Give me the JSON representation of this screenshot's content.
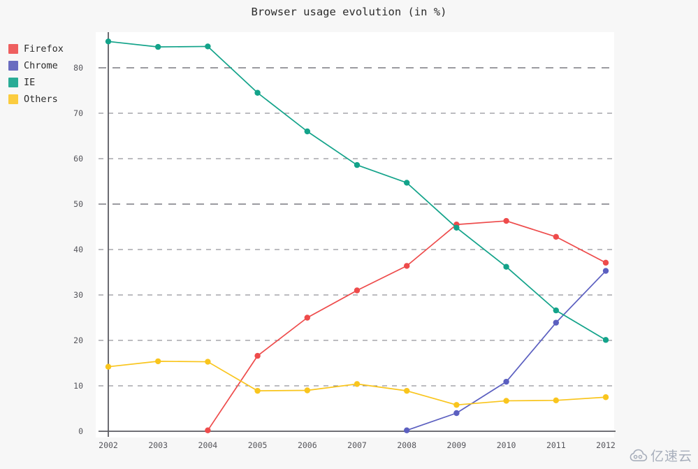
{
  "chart_data": {
    "type": "line",
    "title": "Browser usage evolution (in %)",
    "xlabel": "",
    "ylabel": "",
    "grid": true,
    "legend_position": "top-left-outside",
    "x": [
      2002,
      2003,
      2004,
      2005,
      2006,
      2007,
      2008,
      2009,
      2010,
      2011,
      2012
    ],
    "categories": [
      "2002",
      "2003",
      "2004",
      "2005",
      "2006",
      "2007",
      "2008",
      "2009",
      "2010",
      "2011",
      "2012"
    ],
    "xlim": [
      2002,
      2012
    ],
    "ylim": [
      0,
      86
    ],
    "yticks": [
      0,
      10,
      20,
      30,
      40,
      50,
      60,
      70,
      80
    ],
    "ytick_labels": [
      "0",
      "10",
      "20",
      "30",
      "40",
      "50",
      "60",
      "70",
      "80"
    ],
    "series": [
      {
        "name": "Firefox",
        "color": "#ee4b4b",
        "values": [
          null,
          null,
          0.2,
          16.6,
          25.0,
          31.0,
          36.4,
          45.5,
          46.3,
          42.8,
          37.1
        ]
      },
      {
        "name": "Chrome",
        "color": "#5b5fc0",
        "values": [
          null,
          null,
          null,
          null,
          null,
          null,
          0.2,
          4.0,
          10.9,
          23.9,
          35.3
        ]
      },
      {
        "name": "IE",
        "color": "#13a38a",
        "values": [
          85.8,
          84.6,
          84.7,
          74.5,
          66.0,
          58.6,
          54.7,
          44.8,
          36.2,
          26.6,
          20.1
        ]
      },
      {
        "name": "Others",
        "color": "#f9c51d",
        "values": [
          14.2,
          15.4,
          15.3,
          8.9,
          9.0,
          10.4,
          8.9,
          5.8,
          6.7,
          6.8,
          7.5
        ]
      }
    ]
  },
  "legend": {
    "items": [
      {
        "label": "Firefox",
        "color": "#ee5f5f"
      },
      {
        "label": "Chrome",
        "color": "#6a6cc0"
      },
      {
        "label": "IE",
        "color": "#2aac96"
      },
      {
        "label": "Others",
        "color": "#fbcc3f"
      }
    ]
  },
  "watermark": {
    "text": "亿速云",
    "icon": "cloud-icon"
  },
  "theme": {
    "page_background": "#f7f7f7",
    "plot_background": "#ffffff",
    "axis_color": "#5c5c62",
    "grid_color": "#7a7a80",
    "text_color": "#2b2b2b",
    "tick_color": "#55555b"
  }
}
